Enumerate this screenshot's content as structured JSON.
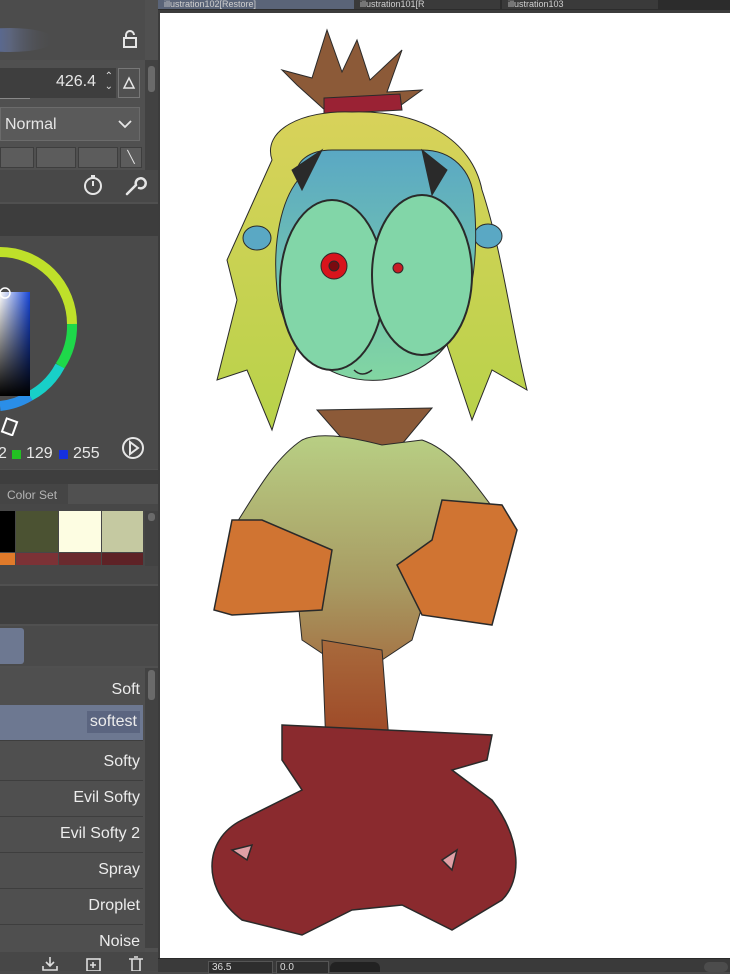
{
  "layer_property": {
    "opacity_value": "426.4",
    "blend_mode": "Normal"
  },
  "color_wheel": {
    "rgb": {
      "r": "2",
      "g": "129",
      "b": "255"
    }
  },
  "color_set": {
    "tab_label": "Color Set",
    "swatches": [
      "#000000",
      "#4b5232",
      "#fdfde2",
      "#c5c9a1"
    ],
    "sub_swatches": [
      "#e07a2a",
      "#7c3236",
      "#6a2a2e",
      "#5e2226"
    ]
  },
  "brush_list": {
    "items": [
      {
        "label": "Soft",
        "selected": false
      },
      {
        "label": "softest",
        "selected": true
      },
      {
        "label": "Softy",
        "selected": false
      },
      {
        "label": "Evil Softy",
        "selected": false
      },
      {
        "label": "Evil Softy 2",
        "selected": false
      },
      {
        "label": "Spray",
        "selected": false
      },
      {
        "label": "Droplet",
        "selected": false
      },
      {
        "label": "Noise",
        "selected": false
      }
    ]
  },
  "document_tabs": [
    {
      "label": "illustration102[Restore]",
      "active": true
    },
    {
      "label": "illustration101[R",
      "active": false
    },
    {
      "label": "illustration103",
      "active": false
    }
  ],
  "status_bar": {
    "zoom": "36.5",
    "angle": "0.0"
  },
  "colors": {
    "panel_bg": "#505050",
    "selected_item": "#6d7891",
    "canvas_bg": "#ffffff"
  }
}
